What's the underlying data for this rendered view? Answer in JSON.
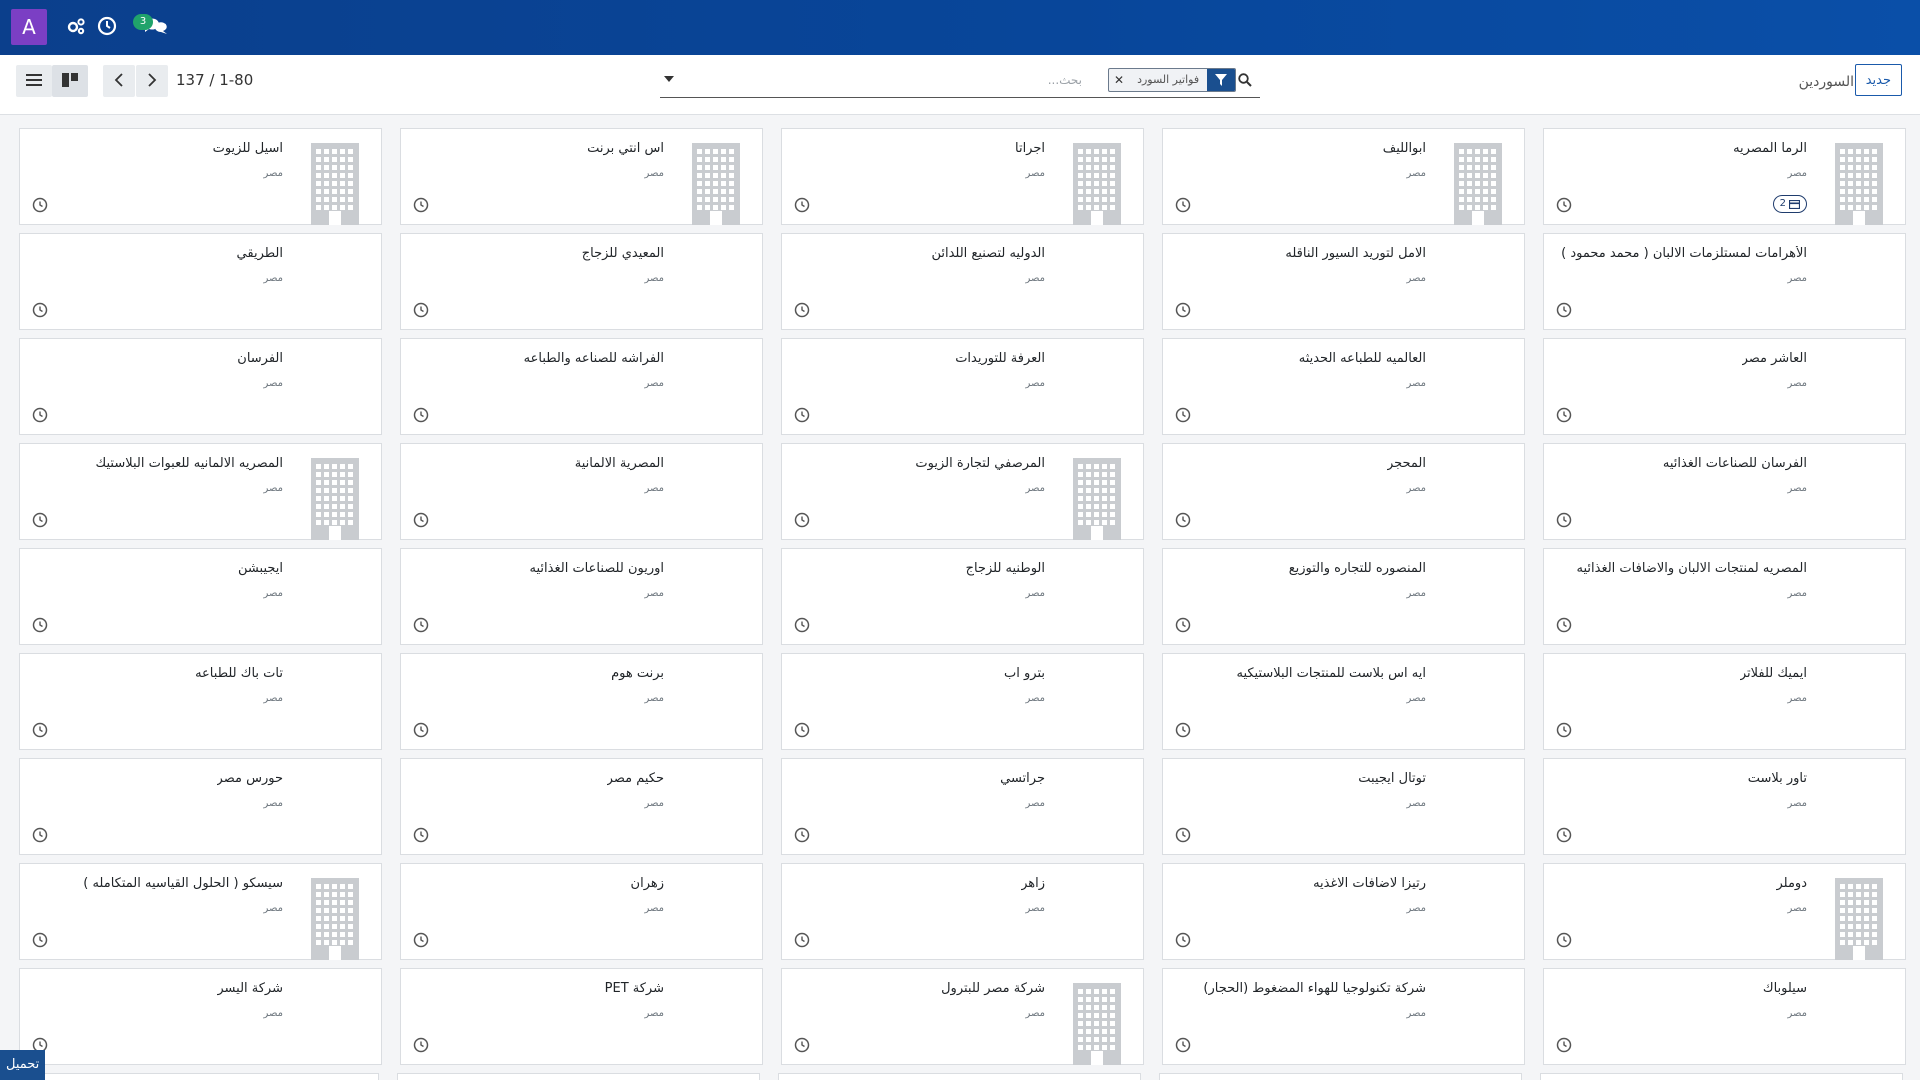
{
  "navbar": {
    "avatar_letter": "A",
    "icons": [
      "gears-icon",
      "clock-icon",
      "chat-icon"
    ],
    "chat_count": "3",
    "colors": {
      "bar": "#0b3f8c",
      "avatar": "#7b3fc4",
      "badge": "#20a36b"
    }
  },
  "control_panel": {
    "breadcrumb": "السوردين",
    "new_label": "جديد",
    "pager": "137 / 1-80",
    "search": {
      "placeholder": "بحث...",
      "facet_label": "فواتير السورد"
    },
    "view_icons": [
      "list-view-icon",
      "kanban-view-icon"
    ]
  },
  "cards": [
    {
      "name": "الرما المصريه",
      "country": "مصر",
      "logo": true,
      "chip": "2"
    },
    {
      "name": "ابوالليف",
      "country": "مصر",
      "logo": true
    },
    {
      "name": "اجراتا",
      "country": "مصر",
      "logo": true
    },
    {
      "name": "اس انتي برنت",
      "country": "مصر",
      "logo": true
    },
    {
      "name": "اسيل للزيوت",
      "country": "مصر",
      "logo": true
    },
    {
      "name": "الأهرامات لمستلزمات الالبان ( محمد محمود )",
      "country": "مصر"
    },
    {
      "name": "الامل لتوريد السيور الناقله",
      "country": "مصر"
    },
    {
      "name": "الدوليه لتصنيع اللدائن",
      "country": "مصر"
    },
    {
      "name": "المعيدي للزجاج",
      "country": "مصر"
    },
    {
      "name": "الطريقي",
      "country": "مصر"
    },
    {
      "name": "العاشر مصر",
      "country": "مصر"
    },
    {
      "name": "العالميه للطباعه الحديثه",
      "country": "مصر"
    },
    {
      "name": "العرفة للتوريدات",
      "country": "مصر"
    },
    {
      "name": "الفراشه للصناعه والطباعه",
      "country": "مصر"
    },
    {
      "name": "الفرسان",
      "country": "مصر"
    },
    {
      "name": "الفرسان للصناعات الغذائيه",
      "country": "مصر"
    },
    {
      "name": "المحجر",
      "country": "مصر"
    },
    {
      "name": "المرصفي لتجارة الزيوت",
      "country": "مصر",
      "logo": true
    },
    {
      "name": "المصرية الالمانية",
      "country": "مصر"
    },
    {
      "name": "المصريه الالمانيه للعبوات البلاستيك",
      "country": "مصر",
      "logo": true
    },
    {
      "name": "المصريه لمنتجات الالبان والاضافات الغذائيه",
      "country": "مصر"
    },
    {
      "name": "المنصوره للتجاره والتوزيع",
      "country": "مصر"
    },
    {
      "name": "الوطنيه للزجاج",
      "country": "مصر"
    },
    {
      "name": "اوريون للصناعات الغذائيه",
      "country": "مصر"
    },
    {
      "name": "ايجيبشن",
      "country": "مصر"
    },
    {
      "name": "ايميك للفلاتر",
      "country": "مصر"
    },
    {
      "name": "ايه اس بلاست للمنتجات البلاستيكيه",
      "country": "مصر"
    },
    {
      "name": "بترو اب",
      "country": "مصر"
    },
    {
      "name": "برنت هوم",
      "country": "مصر"
    },
    {
      "name": "تات باك للطباعه",
      "country": "مصر"
    },
    {
      "name": "تاور بلاست",
      "country": "مصر"
    },
    {
      "name": "توتال ايجيبت",
      "country": "مصر"
    },
    {
      "name": "جراتسي",
      "country": "مصر"
    },
    {
      "name": "حكيم مصر",
      "country": "مصر"
    },
    {
      "name": "حورس مصر",
      "country": "مصر"
    },
    {
      "name": "دوملر",
      "country": "مصر",
      "logo": true
    },
    {
      "name": "رتيزا لاضافات الاغذيه",
      "country": "مصر"
    },
    {
      "name": "زاهر",
      "country": "مصر"
    },
    {
      "name": "زهران",
      "country": "مصر"
    },
    {
      "name": "سيسكو ( الحلول القياسيه المتكامله )",
      "country": "مصر",
      "logo": true
    },
    {
      "name": "سيلوباك",
      "country": "مصر"
    },
    {
      "name": "شركة تكنولوجيا للهواء المضغوط (الحجار)",
      "country": "مصر"
    },
    {
      "name": "شركة مصر للبترول",
      "country": "مصر",
      "logo": true
    },
    {
      "name": "شركة PET",
      "country": "مصر"
    },
    {
      "name": "شركة اليسر",
      "country": "مصر"
    }
  ],
  "footer": {
    "download_label": "تحميل"
  }
}
